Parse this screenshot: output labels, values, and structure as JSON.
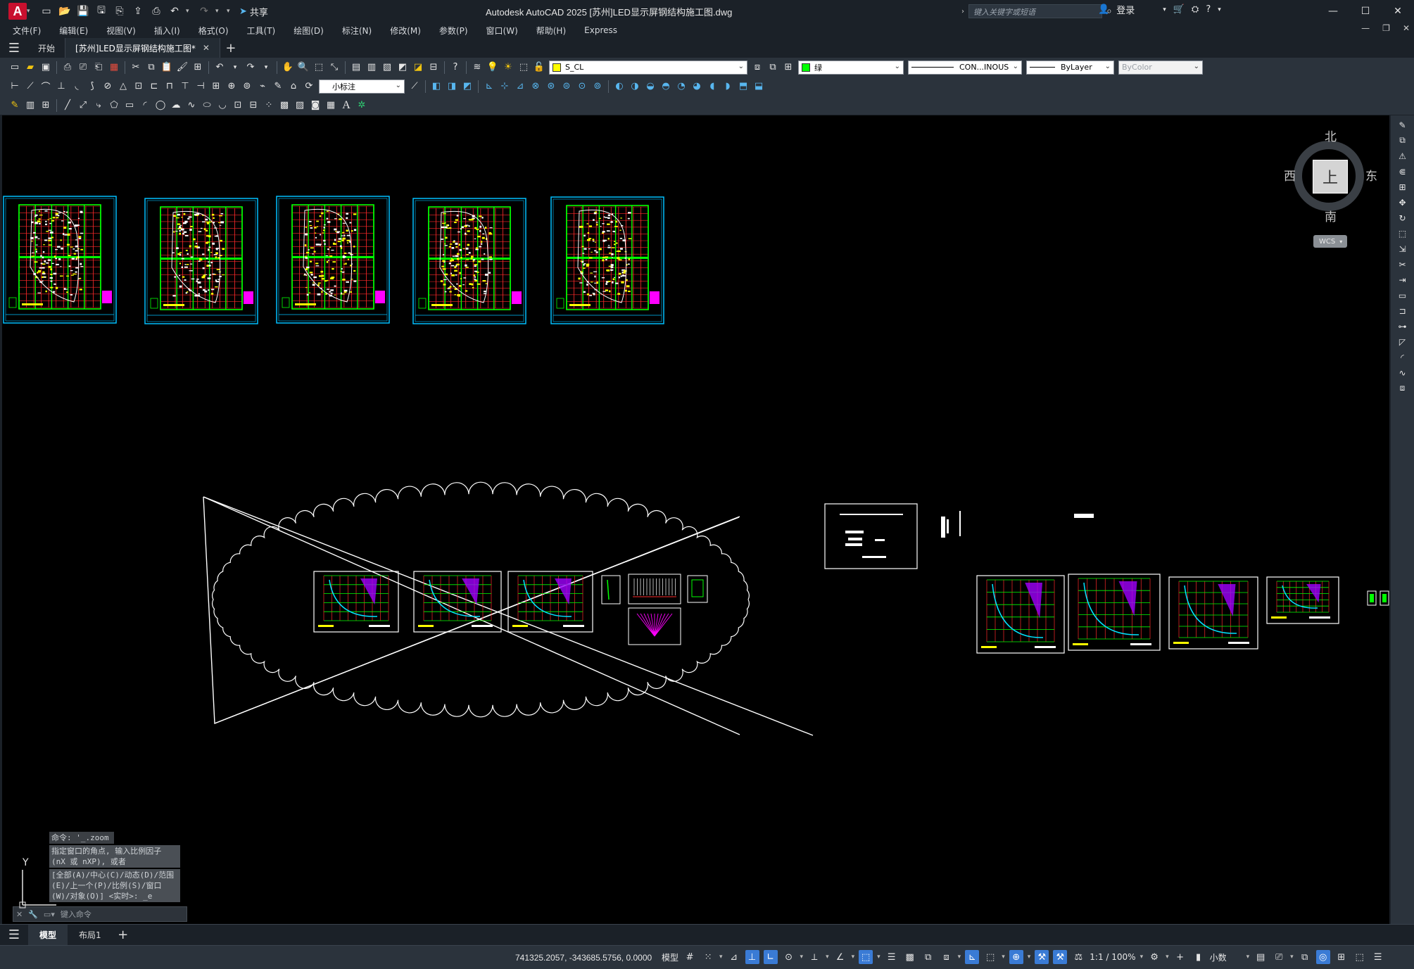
{
  "app": {
    "title": "Autodesk AutoCAD 2025    [苏州]LED显示屏钢结构施工图.dwg",
    "logo": "A",
    "share_label": "共享",
    "search_placeholder": "键入关键字或短语",
    "login_label": "登录"
  },
  "menus": [
    "文件(F)",
    "编辑(E)",
    "视图(V)",
    "插入(I)",
    "格式(O)",
    "工具(T)",
    "绘图(D)",
    "标注(N)",
    "修改(M)",
    "参数(P)",
    "窗口(W)",
    "帮助(H)",
    "Express"
  ],
  "tabs": {
    "start": "开始",
    "document": "[苏州]LED显示屏钢结构施工图*"
  },
  "toolbar": {
    "layer_name": "S_CL",
    "layer_color": "#ffff00",
    "color_name": "绿",
    "color_value": "#00ff00",
    "linetype": "CON...INOUS",
    "lineweight": "ByLayer",
    "plotstyle": "ByColor",
    "dimstyle": "小标注"
  },
  "viewcube": {
    "north": "北",
    "south": "南",
    "east": "东",
    "west": "西",
    "face": "上",
    "wcs": "WCS"
  },
  "command": {
    "lines": [
      "命令: '_.zoom",
      "指定窗口的角点, 输入比例因子 (nX 或 nXP), 或者",
      "[全部(A)/中心(C)/动态(D)/范围(E)/上一个(P)/比例(S)/窗口(W)/对象(O)] <实时>: _e"
    ],
    "input_placeholder": "键入命令"
  },
  "ucs": {
    "y_label": "Y"
  },
  "layouts": [
    "模型",
    "布局1"
  ],
  "status": {
    "coordinates": "741325.2057, -343685.5756, 0.0000",
    "model_label": "模型",
    "scale": "1:1 / 100%",
    "units": "小数"
  },
  "colors": {
    "accent": "#3a7bd5",
    "canvas": "#000000",
    "chrome": "#2b333c",
    "titlebar": "#1b2128"
  }
}
